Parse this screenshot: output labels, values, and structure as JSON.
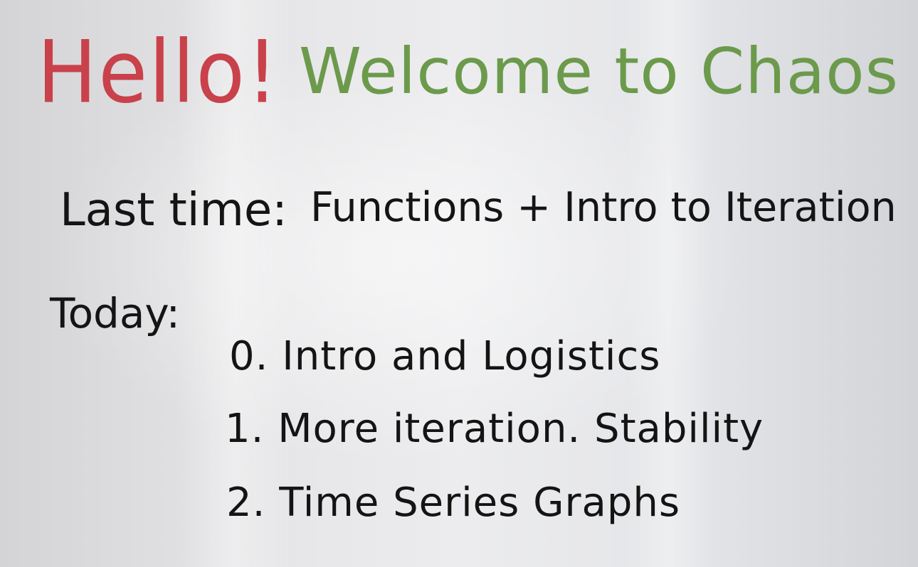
{
  "board": {
    "greeting": "Hello!",
    "welcome": "Welcome to Chaos",
    "last_time_label": "Last time:",
    "last_time_topic": "Functions + Intro to Iteration",
    "today_label": "Today:",
    "agenda": [
      {
        "text": "0. Intro and Logistics"
      },
      {
        "text": "1. More iteration. Stability"
      },
      {
        "text": "2. Time Series Graphs"
      }
    ]
  },
  "colors": {
    "greeting": "#c9414a",
    "welcome": "#6c9a4c",
    "marker_black": "#141414",
    "board": "#e6e6e8"
  }
}
